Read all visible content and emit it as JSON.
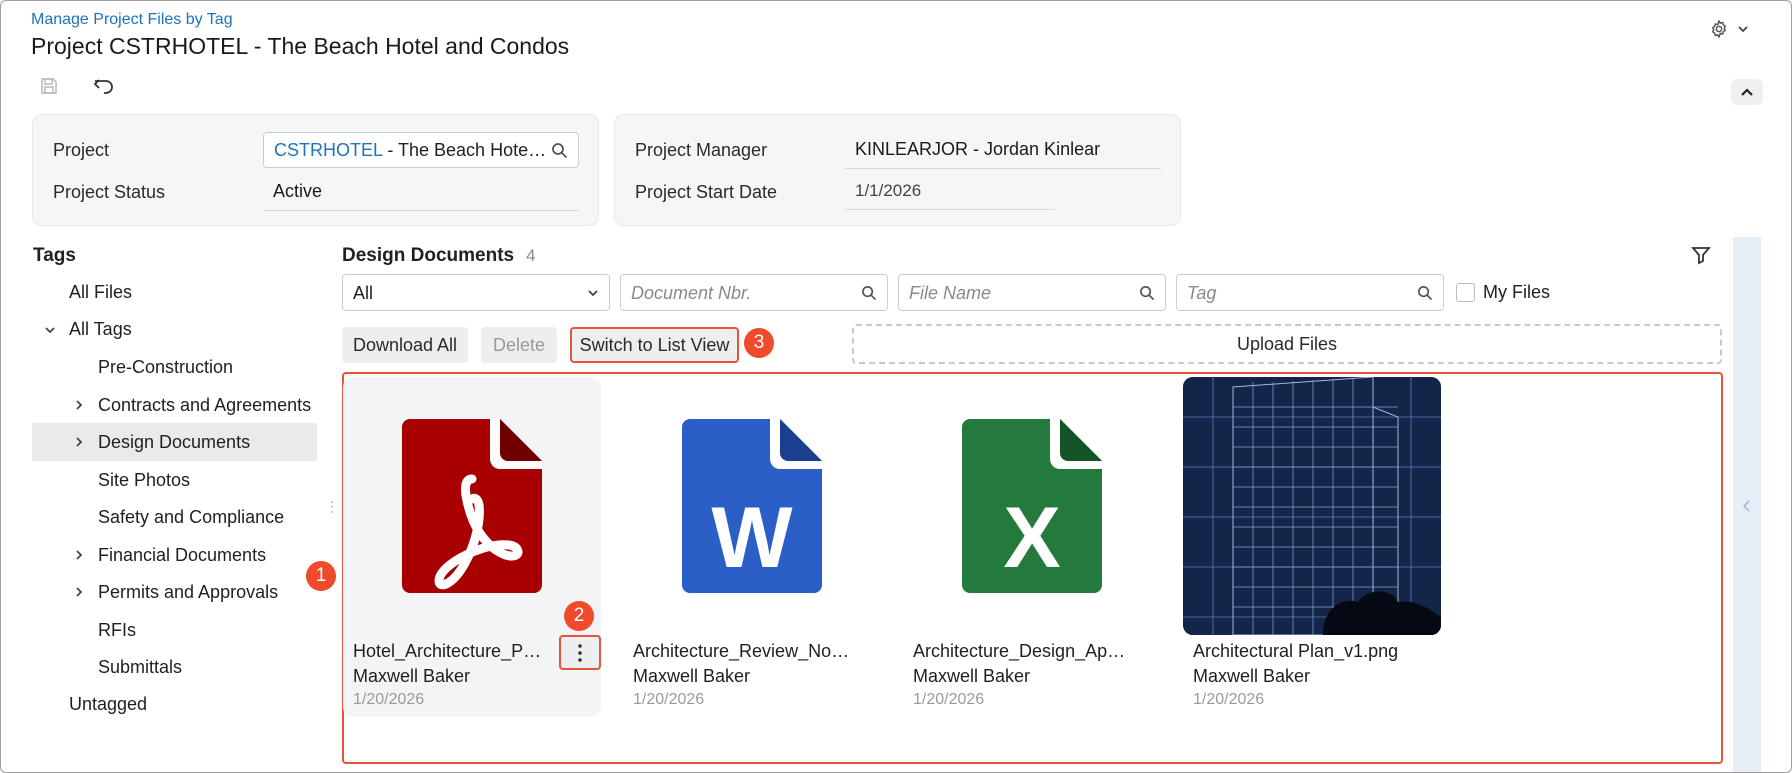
{
  "header": {
    "breadcrumb": "Manage Project Files by Tag",
    "title": "Project CSTRHOTEL - The Beach Hotel and Condos"
  },
  "toolbar": {
    "save_icon": "save-icon",
    "undo_icon": "undo-icon"
  },
  "summary": {
    "project_label": "Project",
    "project_code": "CSTRHOTEL",
    "project_name": " - The Beach Hotel and Condos",
    "status_label": "Project Status",
    "status_value": "Active",
    "manager_label": "Project Manager",
    "manager_value": "KINLEARJOR - Jordan Kinlear",
    "start_label": "Project Start Date",
    "start_value": "1/1/2026"
  },
  "tags": {
    "title": "Tags",
    "all_files": "All Files",
    "all_tags": "All Tags",
    "items": [
      {
        "label": "Pre-Construction",
        "expandable": false
      },
      {
        "label": "Contracts and Agreements",
        "expandable": true
      },
      {
        "label": "Design Documents",
        "expandable": true,
        "selected": true
      },
      {
        "label": "Site Photos",
        "expandable": false
      },
      {
        "label": "Safety and Compliance",
        "expandable": false
      },
      {
        "label": "Financial Documents",
        "expandable": true
      },
      {
        "label": "Permits and Approvals",
        "expandable": true
      },
      {
        "label": "RFIs",
        "expandable": false
      },
      {
        "label": "Submittals",
        "expandable": false
      }
    ],
    "untagged": "Untagged"
  },
  "main": {
    "title": "Design Documents",
    "count": "4",
    "filters": {
      "type_value": "All",
      "doc_nbr_placeholder": "Document Nbr.",
      "file_name_placeholder": "File Name",
      "tag_placeholder": "Tag",
      "my_files_label": "My Files"
    },
    "buttons": {
      "download_all": "Download All",
      "delete": "Delete",
      "switch_view": "Switch to List View",
      "upload": "Upload Files"
    },
    "callouts": [
      "1",
      "2",
      "3"
    ],
    "files": [
      {
        "name": "Hotel_Architecture_Plan.pdf",
        "owner": "Maxwell Baker",
        "date": "1/20/2026",
        "kind": "pdf"
      },
      {
        "name": "Architecture_Review_Notes.docx",
        "owner": "Maxwell Baker",
        "date": "1/20/2026",
        "kind": "word"
      },
      {
        "name": "Architecture_Design_Approval.xlsx",
        "owner": "Maxwell Baker",
        "date": "1/20/2026",
        "kind": "excel"
      },
      {
        "name": "Architectural Plan_v1.png",
        "owner": "Maxwell Baker",
        "date": "1/20/2026",
        "kind": "image"
      }
    ]
  },
  "colors": {
    "accent": "#1e73be",
    "callout": "#ef4a2a",
    "pdf": "#a80000",
    "word": "#2b5fc7",
    "excel": "#237a3c"
  }
}
